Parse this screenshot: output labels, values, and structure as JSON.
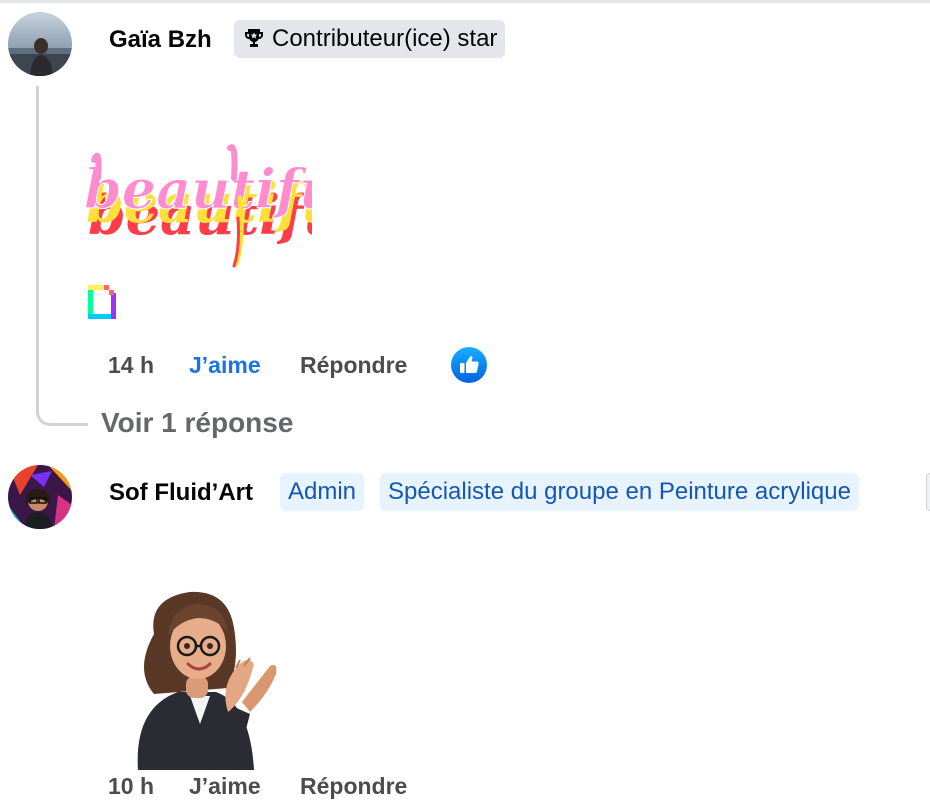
{
  "comments": [
    {
      "author": "Gaïa Bzh",
      "badges": [
        {
          "icon": "trophy-icon",
          "label": "Contributeur(ice) star"
        }
      ],
      "sticker": {
        "text": "beautiful",
        "type": "gif-sticker",
        "source_icon": "giphy-icon"
      },
      "time": "14 h",
      "like_label": "J’aime",
      "like_state": "liked",
      "reply_label": "Répondre",
      "reaction_icon": "like-reaction-icon",
      "view_replies_label": "Voir 1 réponse"
    },
    {
      "author": "Sof Fluid’Art",
      "badges": [
        {
          "label": "Admin"
        },
        {
          "label": "Spécialiste du groupe en Peinture acrylique"
        }
      ],
      "sticker": {
        "type": "avatar-sticker",
        "depicts": "woman-clapping-avatar"
      },
      "time": "10 h",
      "like_label": "J’aime",
      "reply_label": "Répondre"
    }
  ],
  "colors": {
    "link_blue": "#1b74e4",
    "badge_blue_bg": "#e7f3ff",
    "badge_blue_text": "#1557b0",
    "badge_grey_bg": "#e4e6eb",
    "muted_text": "#65676b",
    "thread_line": "#d0d2d6"
  }
}
